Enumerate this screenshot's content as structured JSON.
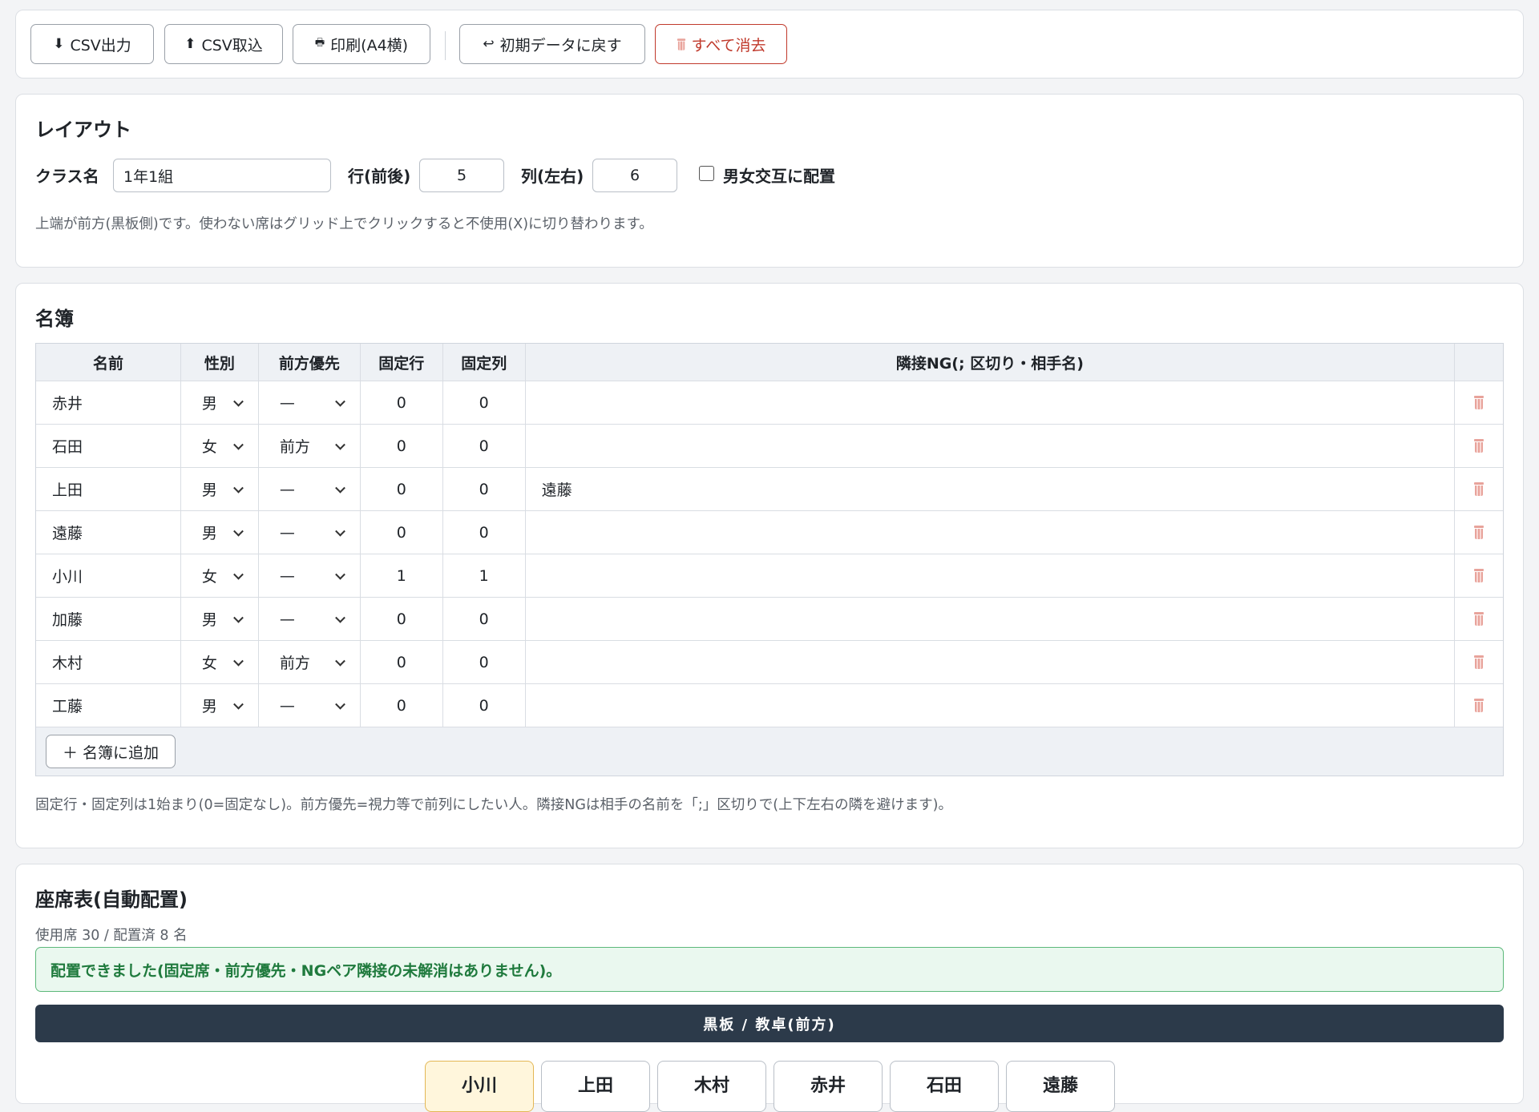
{
  "toolbar": {
    "csv_export": "CSV出力",
    "csv_import": "CSV取込",
    "print": "印刷(A4横)",
    "reset": "初期データに戻す",
    "clear_all": "すべて消去"
  },
  "layout": {
    "title": "レイアウト",
    "class_label": "クラス名",
    "class_value": "1年1組",
    "rows_label": "行(前後)",
    "rows_value": "5",
    "cols_label": "列(左右)",
    "cols_value": "6",
    "alternate_label": "男女交互に配置",
    "alternate_checked": false,
    "hint": "上端が前方(黒板側)です。使わない席はグリッド上でクリックすると不使用(X)に切り替わります。"
  },
  "roster": {
    "title": "名簿",
    "headers": [
      "名前",
      "性別",
      "前方優先",
      "固定行",
      "固定列",
      "隣接NG(; 区切り・相手名)"
    ],
    "rows": [
      {
        "name": "赤井",
        "sex": "男",
        "front": "—",
        "row": "0",
        "col": "0",
        "ng": ""
      },
      {
        "name": "石田",
        "sex": "女",
        "front": "前方",
        "row": "0",
        "col": "0",
        "ng": ""
      },
      {
        "name": "上田",
        "sex": "男",
        "front": "—",
        "row": "0",
        "col": "0",
        "ng": "遠藤"
      },
      {
        "name": "遠藤",
        "sex": "男",
        "front": "—",
        "row": "0",
        "col": "0",
        "ng": ""
      },
      {
        "name": "小川",
        "sex": "女",
        "front": "—",
        "row": "1",
        "col": "1",
        "ng": ""
      },
      {
        "name": "加藤",
        "sex": "男",
        "front": "—",
        "row": "0",
        "col": "0",
        "ng": ""
      },
      {
        "name": "木村",
        "sex": "女",
        "front": "前方",
        "row": "0",
        "col": "0",
        "ng": ""
      },
      {
        "name": "工藤",
        "sex": "男",
        "front": "—",
        "row": "0",
        "col": "0",
        "ng": ""
      }
    ],
    "add_label": "名簿に追加",
    "hint": "固定行・固定列は1始まり(0=固定なし)。前方優先=視力等で前列にしたい人。隣接NGは相手の名前を「;」区切りで(上下左右の隣を避けます)。"
  },
  "seating": {
    "title": "座席表(自動配置)",
    "summary": "使用席 30 / 配置済 8 名",
    "status": "配置できました(固定席・前方優先・NGペア隣接の未解消はありません)。",
    "board_label": "黒板 / 教卓(前方)",
    "first_row": [
      "小川",
      "上田",
      "木村",
      "赤井",
      "石田",
      "遠藤"
    ]
  },
  "colors": {
    "danger": "#c0392b",
    "success": "#1f7a3d",
    "board": "#2c3a4a",
    "fixed_seat": "#fff6dc"
  }
}
